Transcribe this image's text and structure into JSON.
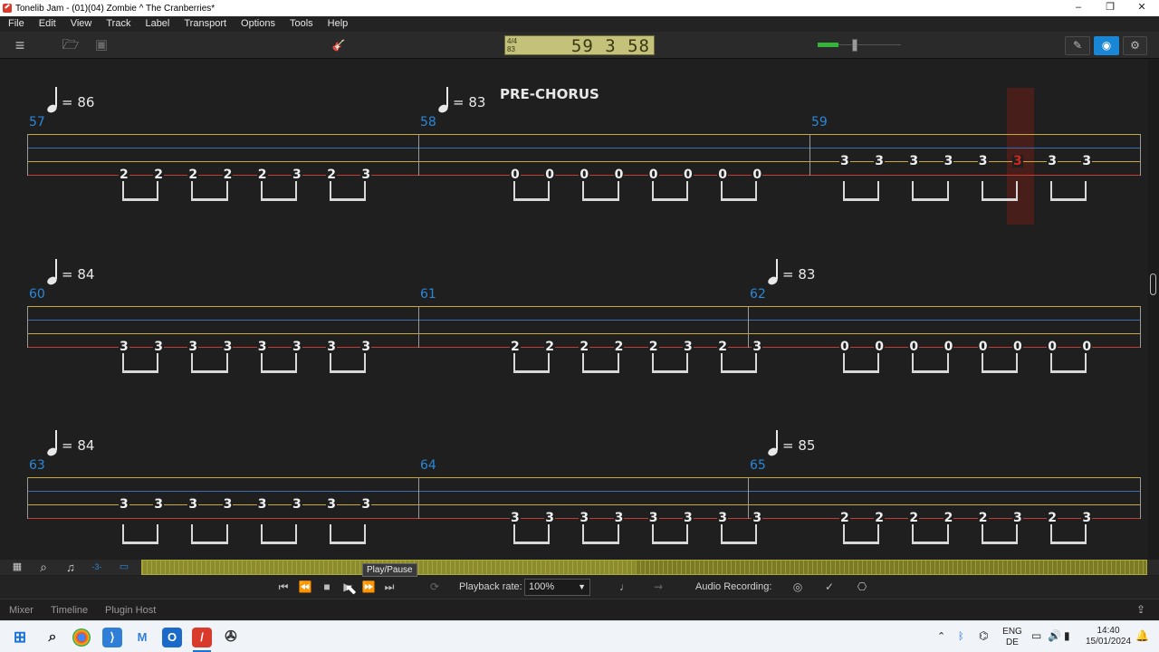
{
  "window": {
    "title": "Tonelib Jam - (01)(04) Zombie ^ The Cranberries*",
    "minimize": "–",
    "maximize": "❐",
    "close": "✕"
  },
  "menu": [
    "File",
    "Edit",
    "View",
    "Track",
    "Label",
    "Transport",
    "Options",
    "Tools",
    "Help"
  ],
  "toolbar": {
    "menu_icon": "≡",
    "open_icon": "🗁",
    "save_icon": "▣",
    "tuner_icon": "🎸",
    "lcd_time_signature": "4/4",
    "lcd_sub": "83",
    "lcd_position": "59 3 58",
    "volume_level": 0.45,
    "pencil_icon": "✎",
    "eye_icon": "◉",
    "mixer_icon": "⚙"
  },
  "score": {
    "section_title": "PRE-CHORUS",
    "rows": [
      {
        "tempos": [
          {
            "value": "= 86"
          },
          {
            "value": "= 83"
          }
        ],
        "bars": [
          "57",
          "58",
          "59"
        ],
        "frets": {
          "b1": [
            "2",
            "2",
            "2",
            "2",
            "2",
            "3",
            "2",
            "3"
          ],
          "b2": [
            "0",
            "0",
            "0",
            "0",
            "0",
            "0",
            "0",
            "0"
          ],
          "b3": [
            "3",
            "3",
            "3",
            "3",
            "3",
            "3",
            "3",
            "3"
          ]
        }
      },
      {
        "tempos": [
          {
            "value": "= 84"
          },
          {
            "value": "= 83"
          }
        ],
        "bars": [
          "60",
          "61",
          "62"
        ],
        "frets": {
          "b1": [
            "3",
            "3",
            "3",
            "3",
            "3",
            "3",
            "3",
            "3"
          ],
          "b2": [
            "2",
            "2",
            "2",
            "2",
            "2",
            "3",
            "2",
            "3"
          ],
          "b3": [
            "0",
            "0",
            "0",
            "0",
            "0",
            "0",
            "0",
            "0"
          ]
        }
      },
      {
        "tempos": [
          {
            "value": "= 84"
          },
          {
            "value": "= 85"
          }
        ],
        "bars": [
          "63",
          "64",
          "65"
        ],
        "frets": {
          "b1": [
            "3",
            "3",
            "3",
            "3",
            "3",
            "3",
            "3",
            "3"
          ],
          "b2": [
            "3",
            "3",
            "3",
            "3",
            "3",
            "3",
            "3",
            "3"
          ],
          "b3": [
            "2",
            "2",
            "2",
            "2",
            "2",
            "3",
            "2",
            "3"
          ]
        }
      }
    ]
  },
  "bottom_icons": {
    "grid": "▦",
    "search": "⌕",
    "note": "♫",
    "triplet": "-3-",
    "view": "▭"
  },
  "transport": {
    "tooltip": "Play/Pause",
    "first": "⏮",
    "rewind": "⏪",
    "stop": "■",
    "play": "▶",
    "forward": "⏩",
    "last": "⏭",
    "loop": "⟳",
    "playback_rate_label": "Playback rate:",
    "playback_rate_value": "100%",
    "metronome": "♩",
    "countin": "⇝",
    "audio_recording_label": "Audio Recording:",
    "rec1": "◎",
    "rec2": "✓",
    "rec3": "⎔"
  },
  "tabs": [
    "Mixer",
    "Timeline",
    "Plugin Host"
  ],
  "upload_icon": "⇪",
  "taskbar": {
    "lang_top": "ENG",
    "lang_bottom": "DE",
    "time": "14:40",
    "date": "15/01/2024"
  }
}
